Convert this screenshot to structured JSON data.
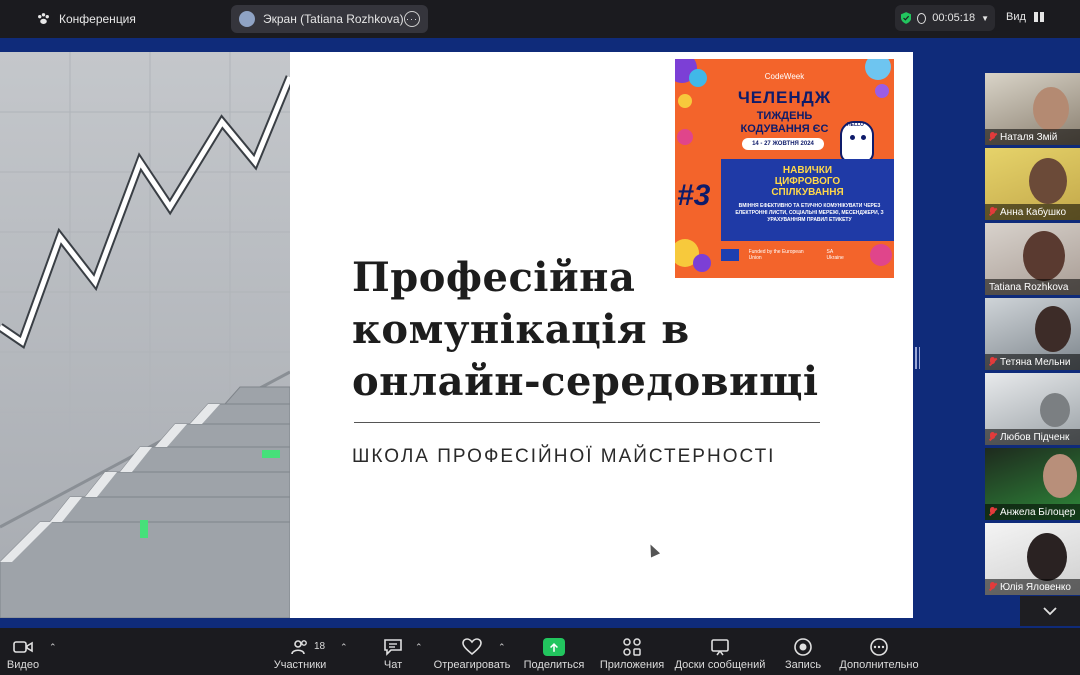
{
  "topbar": {
    "conference_label": "Конференция",
    "screen_label": "Экран (Tatiana Rozhkova)",
    "timer": "00:05:18",
    "view_label": "Вид"
  },
  "slide": {
    "title_lines": [
      "Професійна",
      "комунікація в",
      "онлайн-середовищі"
    ],
    "subtitle": "ШКОЛА ПРОФЕСІЙНОЇ МАЙСТЕРНОСТІ",
    "poster": {
      "brand": "CodeWeek",
      "challenge": "ЧЕЛЕНДЖ",
      "week_line1": "ТИЖДЕНЬ",
      "week_line2": "КОДУВАННЯ ЄС",
      "dates": "14 - 27 ЖОВТНЯ 2024",
      "number": "#3",
      "skills_line1": "НАВИЧКИ",
      "skills_line2": "ЦИФРОВОГО",
      "skills_line3": "СПІЛКУВАННЯ",
      "skills_desc": "ВМІННЯ ЕФЕКТИВНО ТА ЕТИЧНО КОМУНІКУВАТИ ЧЕРЕЗ ЕЛЕКТРОННІ ЛИСТИ, СОЦІАЛЬНІ МЕРЕЖІ, МЕСЕНДЖЕРИ, З УРАХУВАННЯМ ПРАВИЛ ЕТИКЕТУ",
      "bubble": "HELLO",
      "funded": "Funded by the European Union",
      "ukraine": "SA Ukraine"
    }
  },
  "participants": [
    {
      "name": "Наталя Змій",
      "muted": true,
      "active": false
    },
    {
      "name": "Анна Кабушко",
      "muted": true,
      "active": false
    },
    {
      "name": "Tatiana Rozhkova",
      "muted": false,
      "active": true
    },
    {
      "name": "Тетяна Мельни",
      "muted": true,
      "active": false
    },
    {
      "name": "Любов Підченк",
      "muted": true,
      "active": false
    },
    {
      "name": "Анжела Білоцер",
      "muted": true,
      "active": false
    },
    {
      "name": "Юлія Яловенко",
      "muted": true,
      "active": false
    }
  ],
  "toolbar": {
    "video": "Видео",
    "participants": "Участники",
    "participants_count": "18",
    "chat": "Чат",
    "react": "Отреагировать",
    "share": "Поделиться",
    "apps": "Приложения",
    "whiteboards": "Доски сообщений",
    "record": "Запись",
    "more": "Дополнительно"
  },
  "colors": {
    "background": "#0f2b7a",
    "bars": "#1b1b1f",
    "share_green": "#22c55e",
    "active_speaker": "#2fe08f",
    "muted_red": "#e23b3b"
  }
}
